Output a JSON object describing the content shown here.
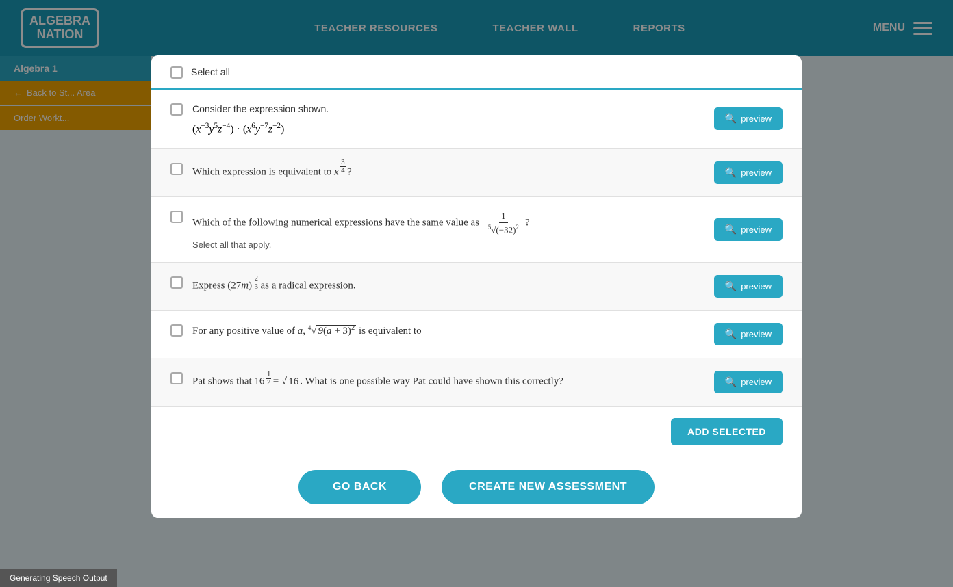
{
  "nav": {
    "logo_line1": "ALGEBRA",
    "logo_line2": "NATION",
    "links": [
      {
        "label": "TEACHER RESOURCES",
        "id": "teacher-resources"
      },
      {
        "label": "TEACHER WALL",
        "id": "teacher-wall"
      },
      {
        "label": "REPORTS",
        "id": "reports"
      }
    ],
    "menu_label": "MENU"
  },
  "sidebar": {
    "algebra_label": "Algebra 1",
    "back_label": "Back to St... Area",
    "order_label": "Order Workt..."
  },
  "modal": {
    "select_all_label": "Select all",
    "questions": [
      {
        "id": "q1",
        "text": "Consider the expression shown.",
        "math_html": "(x<sup>−3</sup>y<sup>5</sup>z<sup>−4</sup>) · (x<sup>6</sup>y<sup>−7</sup>z<sup>−2</sup>)",
        "sub_text": "",
        "preview_label": "preview"
      },
      {
        "id": "q2",
        "text": "Which expression is equivalent to x<sup>3/4</sup> ?",
        "math_html": "",
        "sub_text": "",
        "preview_label": "preview"
      },
      {
        "id": "q3",
        "text": "Which of the following numerical expressions have the same value as",
        "math_inline": "1 / (5√(-32)²)",
        "sub_text": "Select all that apply.",
        "preview_label": "preview"
      },
      {
        "id": "q4",
        "text": "Express (27m)<sup>2/3</sup> as a radical expression.",
        "math_html": "",
        "sub_text": "",
        "preview_label": "preview"
      },
      {
        "id": "q5",
        "text": "For any positive value of a, ⁴√(9(a+3)²) is equivalent to",
        "math_html": "",
        "sub_text": "",
        "preview_label": "preview"
      },
      {
        "id": "q6",
        "text": "Pat shows that 16<sup>1/2</sup> = √16. What is one possible way Pat could have shown this correctly?",
        "math_html": "",
        "sub_text": "",
        "preview_label": "preview"
      }
    ],
    "add_selected_label": "ADD SELECTED",
    "go_back_label": "GO BACK",
    "create_assessment_label": "CREATE NEW ASSESSMENT"
  },
  "status": {
    "text": "Generating Speech Output"
  }
}
